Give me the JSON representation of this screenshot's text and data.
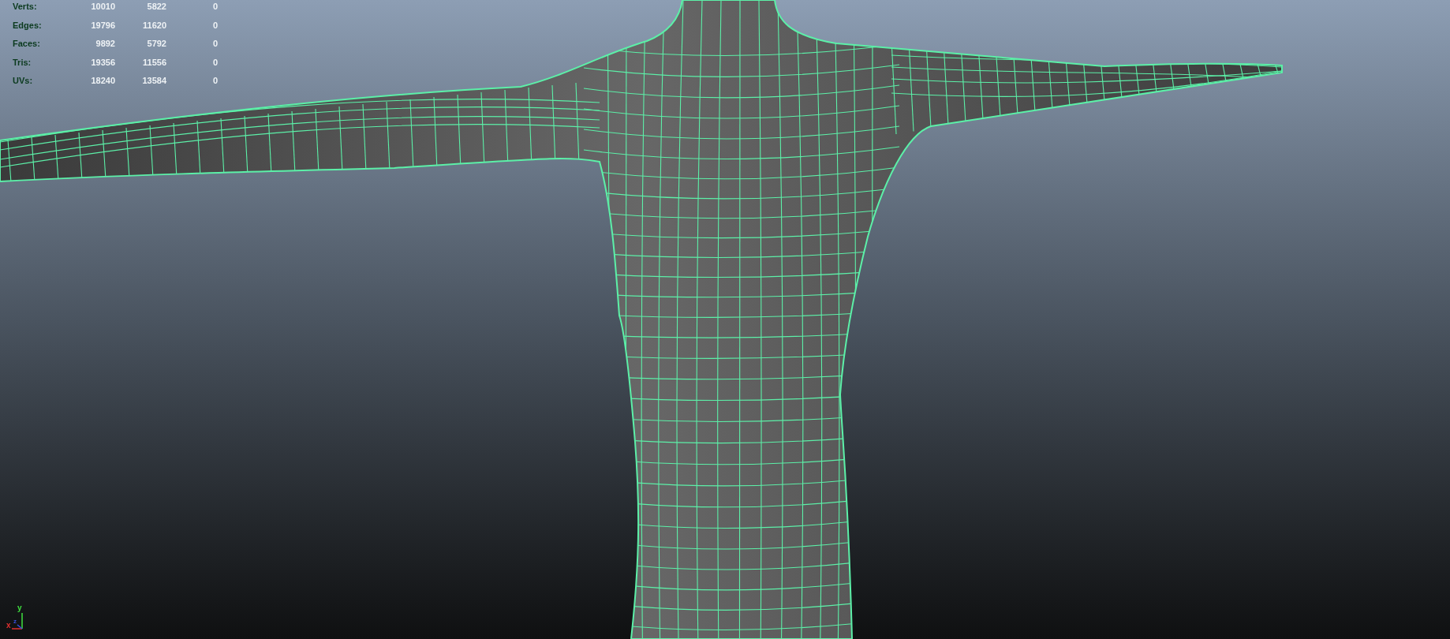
{
  "hud": {
    "rows": [
      {
        "label": "Verts:",
        "values": [
          "10010",
          "5822",
          "0"
        ]
      },
      {
        "label": "Edges:",
        "values": [
          "19796",
          "11620",
          "0"
        ]
      },
      {
        "label": "Faces:",
        "values": [
          "9892",
          "5792",
          "0"
        ]
      },
      {
        "label": "Tris:",
        "values": [
          "19356",
          "11556",
          "0"
        ]
      },
      {
        "label": "UVs:",
        "values": [
          "18240",
          "13584",
          "0"
        ]
      }
    ]
  },
  "axis_gizmo": {
    "x_label": "x",
    "y_label": "y",
    "z_label": "z"
  }
}
